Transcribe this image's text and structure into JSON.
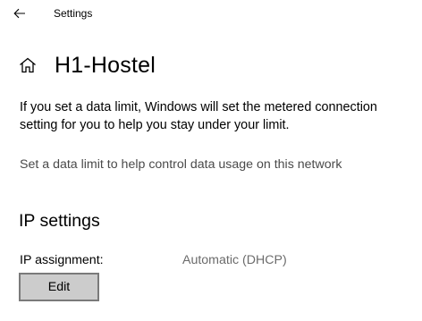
{
  "titlebar": {
    "back_icon": "arrow-left-icon",
    "app_title": "Settings"
  },
  "header": {
    "home_icon": "home-icon",
    "title": "H1-Hostel"
  },
  "main": {
    "description": "If you set a data limit, Windows will set the metered connection setting for you to help you stay under your limit.",
    "data_limit_link": "Set a data limit to help control data usage on this network",
    "ip_section": {
      "heading": "IP settings",
      "assignment_label": "IP assignment:",
      "assignment_value": "Automatic (DHCP)",
      "edit_label": "Edit"
    }
  }
}
